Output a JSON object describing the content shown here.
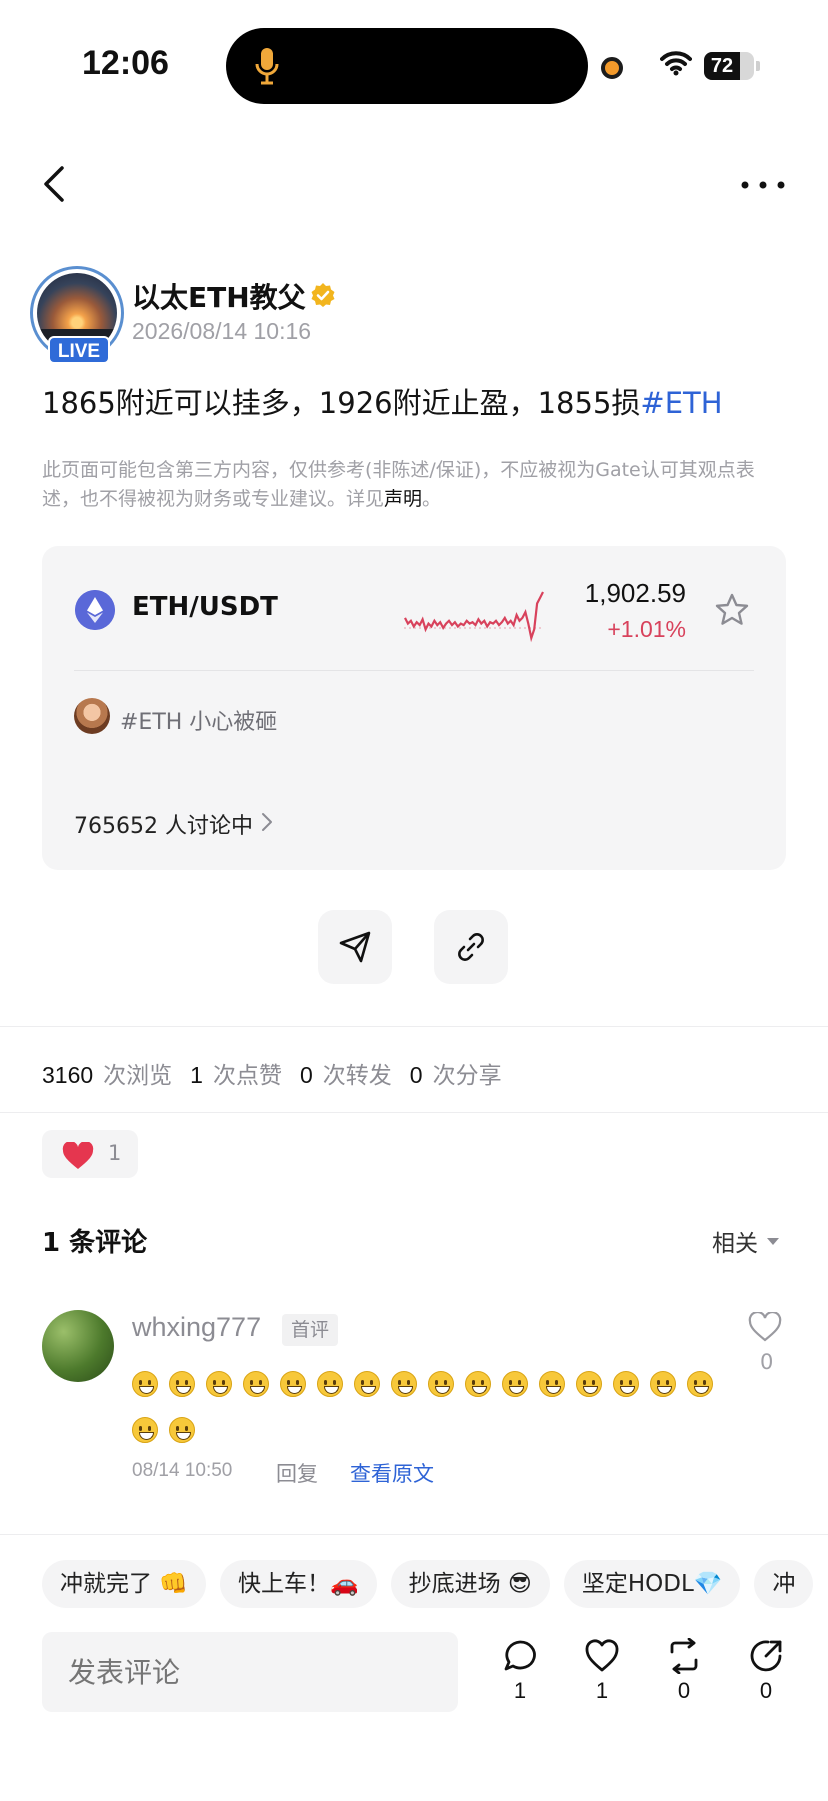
{
  "status_bar": {
    "time": "12:06",
    "battery": "72",
    "battery_level": 0.72
  },
  "post": {
    "author": {
      "name": "以太ETH教父",
      "live_badge": "LIVE"
    },
    "timestamp": "2026/08/14 10:16",
    "text": "1865附近可以挂多，1926附近止盈，1855损",
    "tag": "#ETH",
    "disclaimer": "此页面可能包含第三方内容，仅供参考(非陈述/保证)，不应被视为Gate认可其观点表述，也不得被视为财务或专业建议。详见",
    "disclaimer_link": "声明",
    "disclaimer_end": "。"
  },
  "market_card": {
    "pair": "ETH/USDT",
    "price": "1,902.59",
    "change": "+1.01%",
    "topic": "#ETH 小心被砸",
    "discussion": "765652 人讨论中",
    "sparkline": [
      22,
      26,
      24,
      28,
      25,
      27,
      23,
      30,
      26,
      28,
      24,
      27,
      25,
      29,
      26,
      24,
      27,
      25,
      28,
      26,
      27,
      24,
      26,
      25,
      27,
      23,
      26,
      24,
      28,
      25,
      26,
      24,
      27,
      25,
      22,
      26,
      24,
      27,
      20,
      24,
      22,
      18,
      26,
      36,
      30,
      12,
      8,
      4
    ]
  },
  "stats": {
    "views": "3160",
    "views_label": "次浏览",
    "likes": "1",
    "likes_label": "次点赞",
    "reposts": "0",
    "reposts_label": "次转发",
    "shares": "0",
    "shares_label": "次分享"
  },
  "reaction": {
    "count": "1"
  },
  "comments": {
    "title": "1 条评论",
    "sort": "相关",
    "items": [
      {
        "user": "whxing777",
        "badge": "首评",
        "likes": "0",
        "emoji": "😃",
        "emoji_count": 18,
        "time": "08/14 10:50",
        "reply": "回复",
        "view_original": "查看原文"
      }
    ]
  },
  "quick_replies": [
    "冲就完了 👊",
    "快上车！🚗",
    "抄底进场 😎",
    "坚定HODL💎",
    "冲"
  ],
  "bottom_bar": {
    "input_placeholder": "发表评论",
    "comment_count": "1",
    "like_count": "1",
    "repost_count": "0",
    "share_count": "0"
  },
  "colors": {
    "accent_blue": "#2e63d6",
    "down_red": "#d8425c",
    "live_blue": "#2f6bd8"
  }
}
